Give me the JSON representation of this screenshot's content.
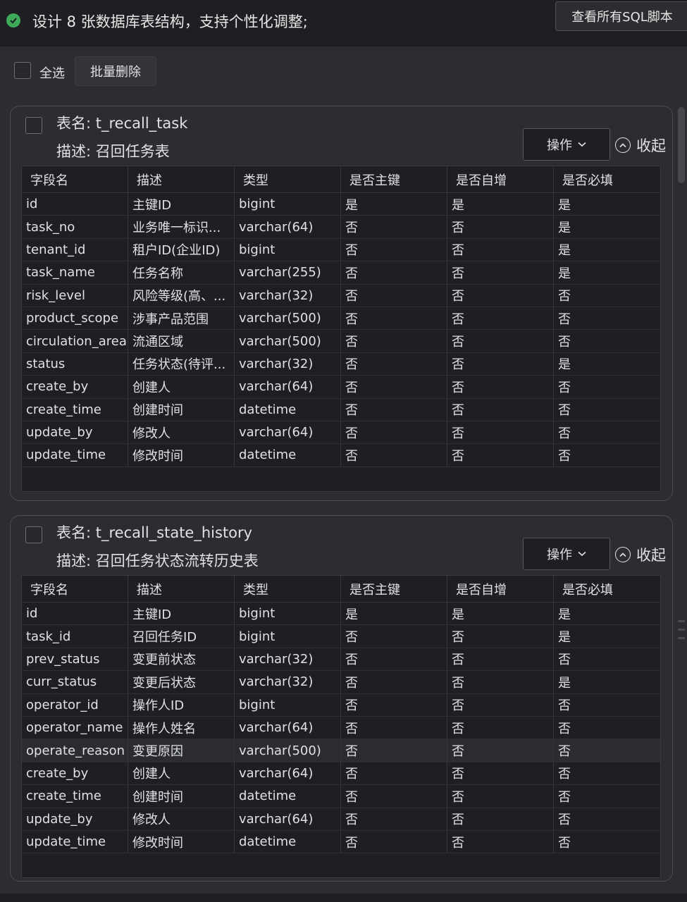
{
  "header": {
    "status_text": "设计 8 张数据库表结构，支持个性化调整;",
    "view_sql_label": "查看所有SQL脚本"
  },
  "toolbar": {
    "select_all_label": "全选",
    "batch_delete_label": "批量删除"
  },
  "columns": [
    "字段名",
    "描述",
    "类型",
    "是否主键",
    "是否自增",
    "是否必填"
  ],
  "tables": [
    {
      "name": "表名: t_recall_task",
      "desc": "描述: 召回任务表",
      "op_label": "操作",
      "collapse_label": "收起",
      "rows": [
        [
          "id",
          "主键ID",
          "bigint",
          "是",
          "是",
          "是"
        ],
        [
          "task_no",
          "业务唯一标识...",
          "varchar(64)",
          "否",
          "否",
          "是"
        ],
        [
          "tenant_id",
          "租户ID(企业ID)",
          "bigint",
          "否",
          "否",
          "是"
        ],
        [
          "task_name",
          "任务名称",
          "varchar(255)",
          "否",
          "否",
          "是"
        ],
        [
          "risk_level",
          "风险等级(高、...",
          "varchar(32)",
          "否",
          "否",
          "否"
        ],
        [
          "product_scope",
          "涉事产品范围",
          "varchar(500)",
          "否",
          "否",
          "否"
        ],
        [
          "circulation_area",
          "流通区域",
          "varchar(500)",
          "否",
          "否",
          "否"
        ],
        [
          "status",
          "任务状态(待评...",
          "varchar(32)",
          "否",
          "否",
          "是"
        ],
        [
          "create_by",
          "创建人",
          "varchar(64)",
          "否",
          "否",
          "否"
        ],
        [
          "create_time",
          "创建时间",
          "datetime",
          "否",
          "否",
          "否"
        ],
        [
          "update_by",
          "修改人",
          "varchar(64)",
          "否",
          "否",
          "否"
        ],
        [
          "update_time",
          "修改时间",
          "datetime",
          "否",
          "否",
          "否"
        ]
      ]
    },
    {
      "name": "表名: t_recall_state_history",
      "desc": "描述: 召回任务状态流转历史表",
      "op_label": "操作",
      "collapse_label": "收起",
      "rows": [
        [
          "id",
          "主键ID",
          "bigint",
          "是",
          "是",
          "是"
        ],
        [
          "task_id",
          "召回任务ID",
          "bigint",
          "否",
          "否",
          "是"
        ],
        [
          "prev_status",
          "变更前状态",
          "varchar(32)",
          "否",
          "否",
          "否"
        ],
        [
          "curr_status",
          "变更后状态",
          "varchar(32)",
          "否",
          "否",
          "是"
        ],
        [
          "operator_id",
          "操作人ID",
          "bigint",
          "否",
          "否",
          "否"
        ],
        [
          "operator_name",
          "操作人姓名",
          "varchar(64)",
          "否",
          "否",
          "否"
        ],
        [
          "operate_reason",
          "变更原因",
          "varchar(500)",
          "否",
          "否",
          "否"
        ],
        [
          "create_by",
          "创建人",
          "varchar(64)",
          "否",
          "否",
          "否"
        ],
        [
          "create_time",
          "创建时间",
          "datetime",
          "否",
          "否",
          "否"
        ],
        [
          "update_by",
          "修改人",
          "varchar(64)",
          "否",
          "否",
          "否"
        ],
        [
          "update_time",
          "修改时间",
          "datetime",
          "否",
          "否",
          "否"
        ]
      ]
    }
  ]
}
